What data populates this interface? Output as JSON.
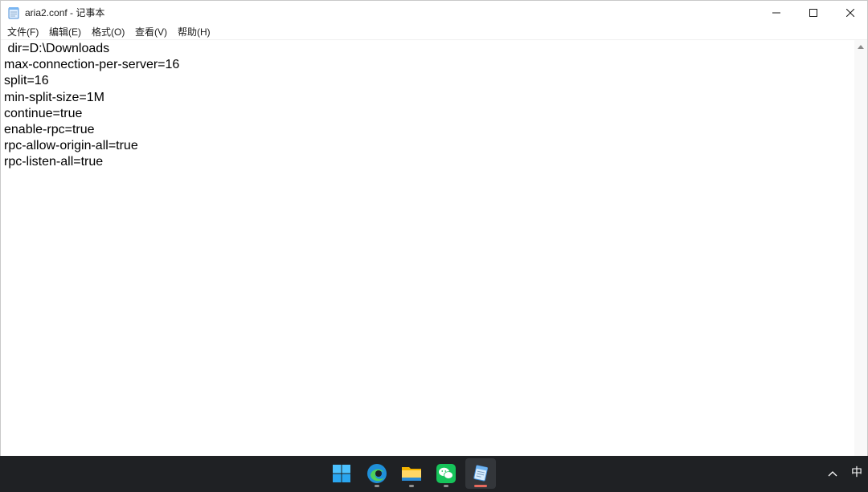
{
  "window": {
    "title": "aria2.conf - 记事本"
  },
  "menu": {
    "items": [
      {
        "label": "文件(F)"
      },
      {
        "label": "编辑(E)"
      },
      {
        "label": "格式(O)"
      },
      {
        "label": "查看(V)"
      },
      {
        "label": "帮助(H)"
      }
    ]
  },
  "editor": {
    "lines": [
      " dir=D:\\Downloads",
      "max-connection-per-server=16",
      "split=16",
      "min-split-size=1M",
      "continue=true",
      "enable-rpc=true",
      "rpc-allow-origin-all=true",
      "rpc-listen-all=true"
    ]
  },
  "taskbar": {
    "apps": [
      {
        "icon": "windows-start-icon"
      },
      {
        "icon": "edge-browser-icon"
      },
      {
        "icon": "file-explorer-icon"
      },
      {
        "icon": "wechat-icon"
      },
      {
        "icon": "notepad-icon",
        "active": true
      }
    ],
    "ime_label": "中"
  }
}
